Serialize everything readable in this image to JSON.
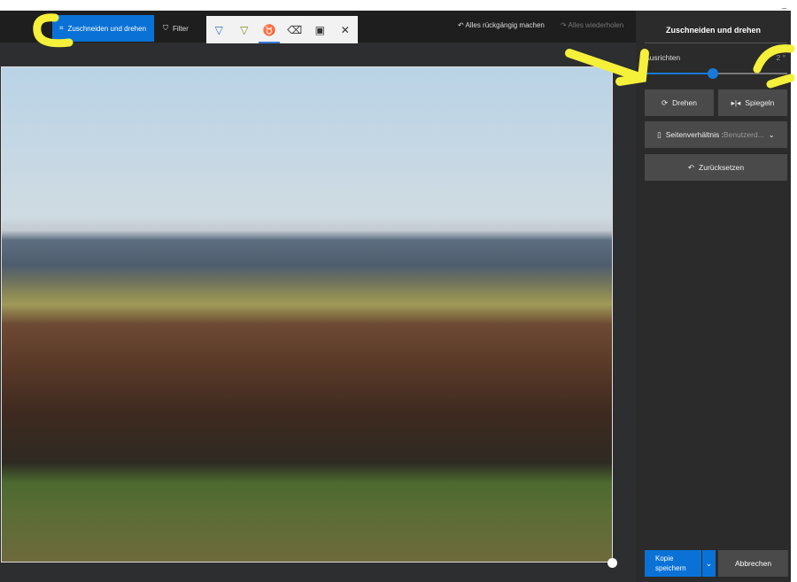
{
  "toolbar": {
    "crop_label": "Zuschneiden und drehen",
    "filter_label": "Filter",
    "undo_all": "Alles rückgängig machen",
    "redo_all": "Alles wiederholen"
  },
  "markup_tools": [
    "ballpoint-pen",
    "pencil",
    "calligraphy-pen",
    "eraser",
    "save",
    "close"
  ],
  "panel": {
    "title": "Zuschneiden und drehen",
    "straighten_label": "Ausrichten",
    "straighten_value": "2 °",
    "straighten_fraction": 0.48,
    "rotate": "Drehen",
    "flip": "Spiegeln",
    "aspect_label": "Seitenverhältnis : ",
    "aspect_value": "Benutzerd...",
    "reset": "Zurücksetzen",
    "save_copy": "Kopie speichern",
    "cancel": "Abbrechen"
  },
  "colors": {
    "accent": "#0a72d6",
    "annotation": "#f5f03a"
  }
}
